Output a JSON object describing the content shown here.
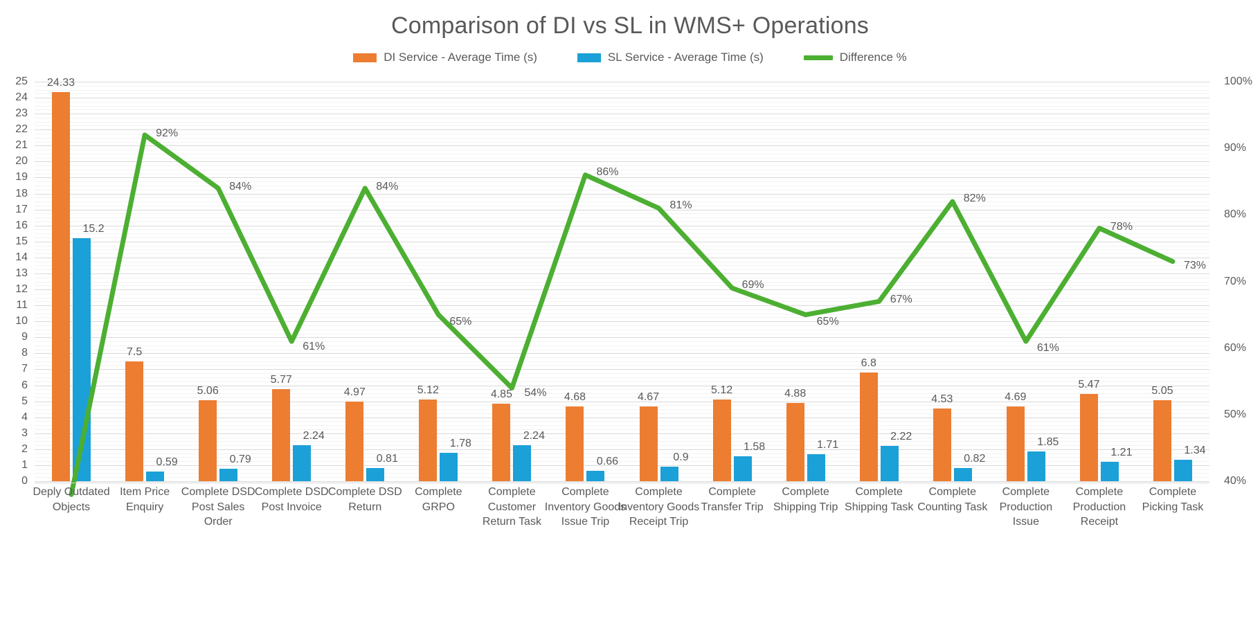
{
  "chart_data": {
    "type": "bar",
    "title": "Comparison of DI vs SL in WMS+ Operations",
    "xlabel": "",
    "ylabel": "",
    "ylim": [
      0,
      25
    ],
    "y2lim": [
      40,
      100
    ],
    "grid": true,
    "legend_position": "top",
    "categories": [
      "Deply Outdated Objects",
      "Item Price Enquiry",
      "Complete DSD Post Sales Order",
      "Complete DSD Post Invoice",
      "Complete DSD Return",
      "Complete GRPO",
      "Complete Customer Return Task",
      "Complete Inventory Goods Issue Trip",
      "Complete Inventory Goods Receipt Trip",
      "Complete Transfer Trip",
      "Complete Shipping Trip",
      "Complete Shipping Task",
      "Complete Counting Task",
      "Complete Production Issue",
      "Complete Production Receipt",
      "Complete Picking Task"
    ],
    "series": [
      {
        "name": "DI Service - Average Time (s)",
        "type": "bar",
        "color": "#ED7D31",
        "axis": "left",
        "values": [
          24.33,
          7.5,
          5.06,
          5.77,
          4.97,
          5.12,
          4.85,
          4.68,
          4.67,
          5.12,
          4.88,
          6.8,
          4.53,
          4.69,
          5.47,
          5.05
        ],
        "labels": [
          "24.33",
          "7.5",
          "5.06",
          "5.77",
          "4.97",
          "5.12",
          "4.85",
          "4.68",
          "4.67",
          "5.12",
          "4.88",
          "6.8",
          "4.53",
          "4.69",
          "5.47",
          "5.05"
        ]
      },
      {
        "name": "SL Service - Average Time (s)",
        "type": "bar",
        "color": "#1BA0D7",
        "axis": "left",
        "values": [
          15.2,
          0.59,
          0.79,
          2.24,
          0.81,
          1.78,
          2.24,
          0.66,
          0.9,
          1.58,
          1.71,
          2.22,
          0.82,
          1.85,
          1.21,
          1.34
        ],
        "labels": [
          "15.2",
          "0.59",
          "0.79",
          "2.24",
          "0.81",
          "1.78",
          "2.24",
          "0.66",
          "0.9",
          "1.58",
          "1.71",
          "2.22",
          "0.82",
          "1.85",
          "1.21",
          "1.34"
        ]
      },
      {
        "name": "Difference %",
        "type": "line",
        "color": "#4CAF32",
        "axis": "right",
        "values": [
          38,
          92,
          84,
          61,
          84,
          65,
          54,
          86,
          81,
          69,
          65,
          67,
          82,
          61,
          78,
          73
        ],
        "labels": [
          "",
          "92%",
          "84%",
          "61%",
          "84%",
          "65%",
          "54%",
          "86%",
          "81%",
          "69%",
          "65%",
          "67%",
          "82%",
          "61%",
          "78%",
          "73%"
        ]
      }
    ],
    "y_ticks_left": [
      "0",
      "1",
      "2",
      "3",
      "4",
      "5",
      "6",
      "7",
      "8",
      "9",
      "10",
      "11",
      "12",
      "13",
      "14",
      "15",
      "16",
      "17",
      "18",
      "19",
      "20",
      "21",
      "22",
      "23",
      "24",
      "25"
    ],
    "y_ticks_right": [
      "40%",
      "50%",
      "60%",
      "70%",
      "80%",
      "90%",
      "100%"
    ]
  },
  "legend": {
    "items": [
      {
        "label": "DI Service - Average Time (s)",
        "color": "#ED7D31",
        "marker": "bar"
      },
      {
        "label": "SL Service - Average Time (s)",
        "color": "#1BA0D7",
        "marker": "bar"
      },
      {
        "label": "Difference %",
        "color": "#4CAF32",
        "marker": "line"
      }
    ]
  },
  "colors": {
    "di": "#ED7D31",
    "sl": "#1BA0D7",
    "difference": "#4CAF32",
    "text": "#595959",
    "gridline": "#d9d9d9",
    "background": "#ffffff"
  }
}
